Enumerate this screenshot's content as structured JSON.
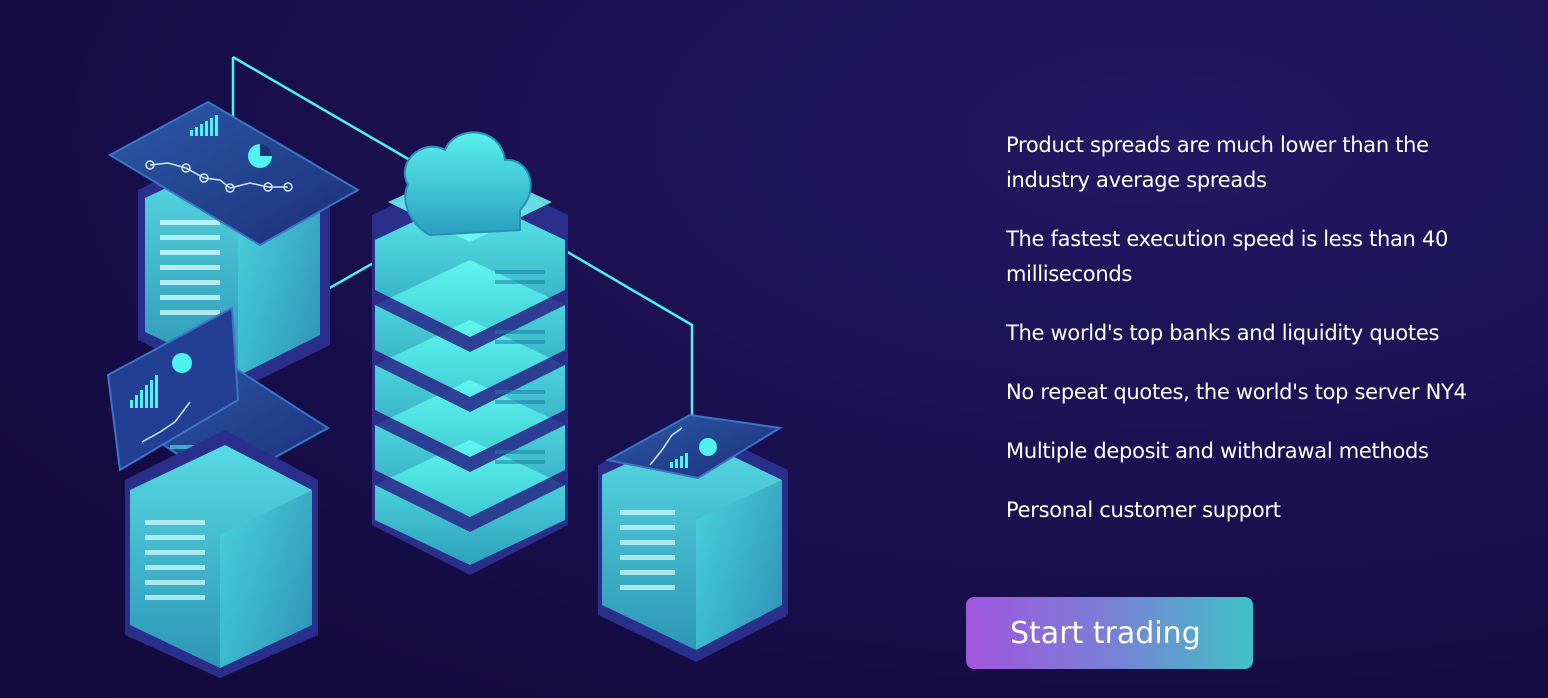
{
  "features": [
    "Product spreads are much lower than the industry average spreads",
    "The fastest execution speed is less than 40 milliseconds",
    "The world's top banks and liquidity quotes",
    "No repeat quotes, the world's top server NY4",
    "Multiple deposit and withdrawal methods",
    "Personal customer support"
  ],
  "cta": {
    "label": "Start trading"
  },
  "illustration": {
    "icons": [
      "server-rack-icon",
      "cloud-icon",
      "laptop-icon",
      "monitor-chart-icon"
    ]
  },
  "colors": {
    "background": "#180e4a",
    "accent_cyan": "#4ef3ee",
    "button_start": "#a056de",
    "button_end": "#3fc1c7"
  }
}
